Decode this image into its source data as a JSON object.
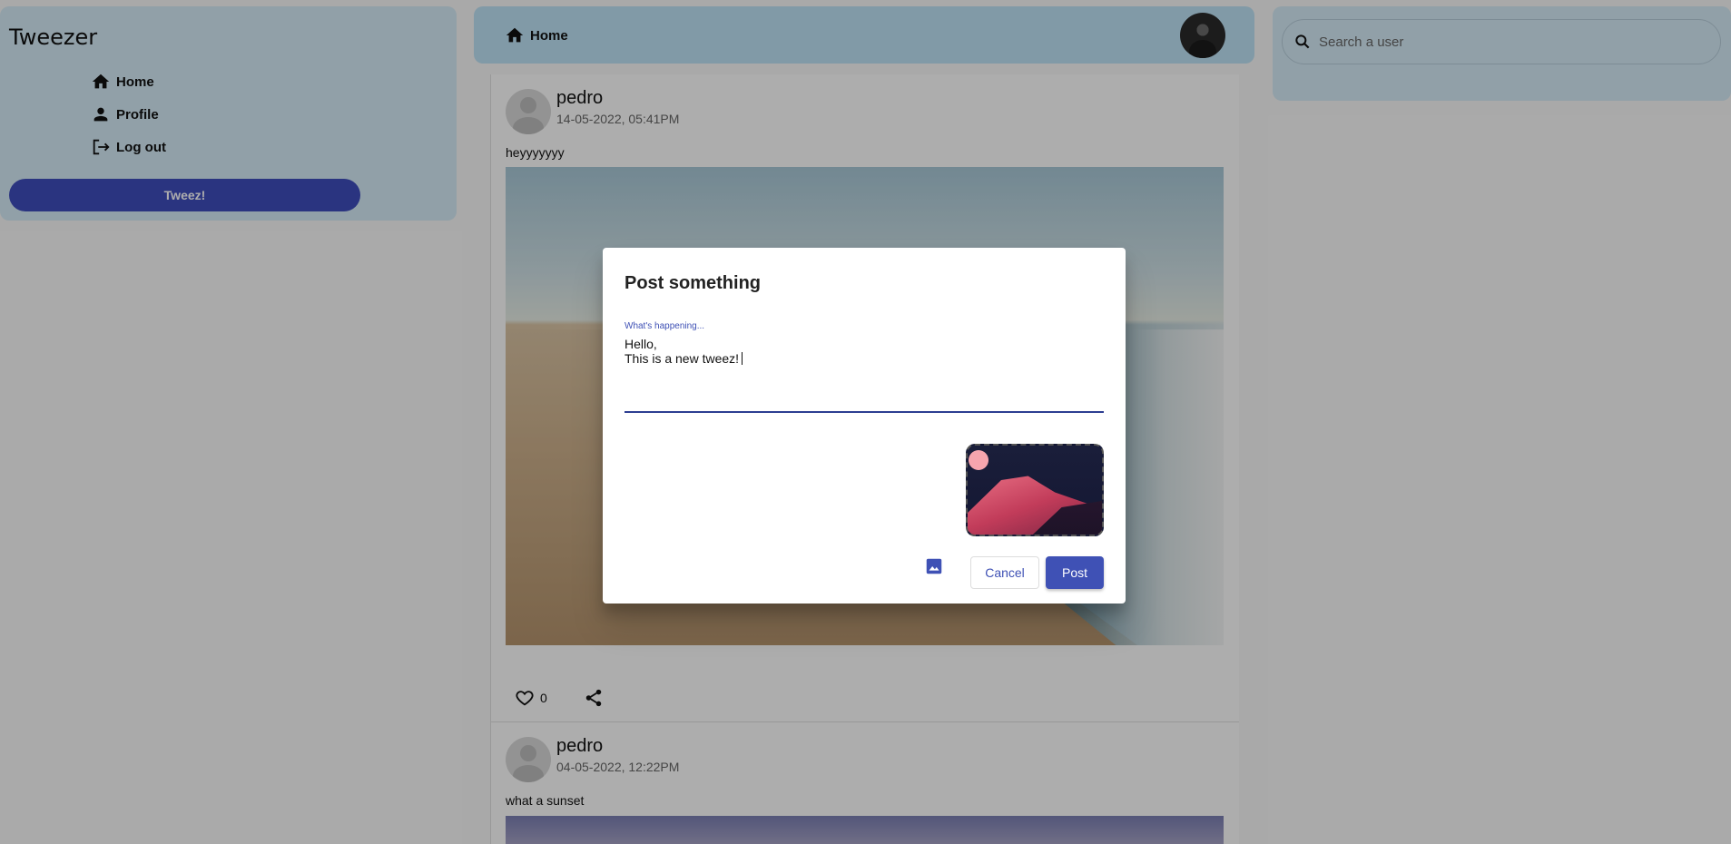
{
  "sidebar": {
    "app_title": "Tweezer",
    "items": [
      {
        "label": "Home",
        "icon": "home-icon"
      },
      {
        "label": "Profile",
        "icon": "person-icon"
      },
      {
        "label": "Log out",
        "icon": "logout-icon"
      }
    ],
    "tweez_label": "Tweez!"
  },
  "topbar": {
    "title": "Home",
    "icon": "home-icon"
  },
  "search": {
    "placeholder": "Search a user",
    "icon": "search-icon"
  },
  "posts": [
    {
      "user": "pedro",
      "date": "14-05-2022, 05:41PM",
      "text": "heyyyyyyy",
      "likes": "0"
    },
    {
      "user": "pedro",
      "date": "04-05-2022, 12:22PM",
      "text": "what a sunset"
    }
  ],
  "dialog": {
    "title": "Post something",
    "field_label": "What's happening...",
    "field_value": "Hello,\nThis is a new tweez!",
    "cancel_label": "Cancel",
    "post_label": "Post",
    "image_icon": "image-icon"
  },
  "colors": {
    "primary": "#3f51b5",
    "panel_bg": "#d6ecf8",
    "topbar_bg": "#bfe3f6"
  }
}
